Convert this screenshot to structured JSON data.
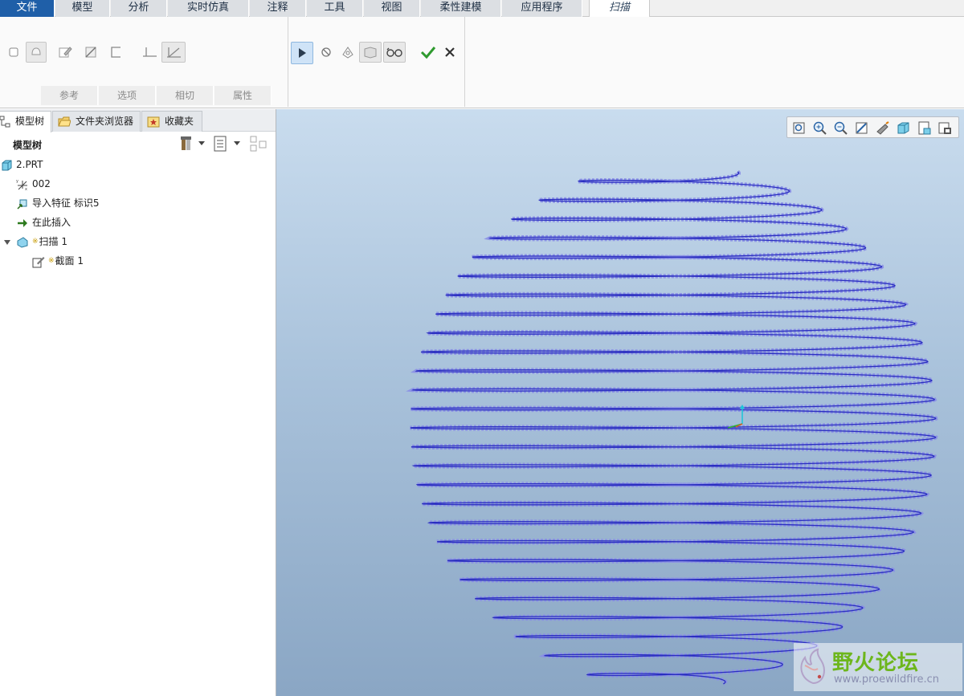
{
  "ribbon": {
    "tabs": [
      {
        "label": "文件"
      },
      {
        "label": "模型"
      },
      {
        "label": "分析"
      },
      {
        "label": "实时仿真"
      },
      {
        "label": "注释"
      },
      {
        "label": "工具"
      },
      {
        "label": "视图"
      },
      {
        "label": "柔性建模"
      },
      {
        "label": "应用程序"
      },
      {
        "label": "扫描"
      }
    ],
    "active_tab": "扫描",
    "groups": [
      "参考",
      "选项",
      "相切",
      "属性"
    ]
  },
  "panel": {
    "tabs": [
      "模型树",
      "文件夹浏览器",
      "收藏夹"
    ],
    "tree_title": "模型树",
    "items": [
      {
        "label": "2.PRT",
        "icon": "part-icon"
      },
      {
        "label": "002",
        "icon": "csys-icon"
      },
      {
        "label": "导入特征 标识5",
        "icon": "import-feature-icon"
      },
      {
        "label": "在此插入",
        "icon": "insert-here-arrow-icon"
      },
      {
        "label": "扫描 1",
        "icon": "sweep-icon"
      },
      {
        "label": "截面 1",
        "icon": "sketch-icon"
      }
    ]
  },
  "watermark": {
    "title": "野火论坛",
    "url": "www.proewildfire.cn"
  },
  "colors": {
    "file_tab": "#1f5fa8",
    "helix": "#2a2ec0",
    "confirm": "#2f9a2f",
    "viewport_top": "#c9dcee",
    "viewport_bottom": "#8aa6c4"
  }
}
